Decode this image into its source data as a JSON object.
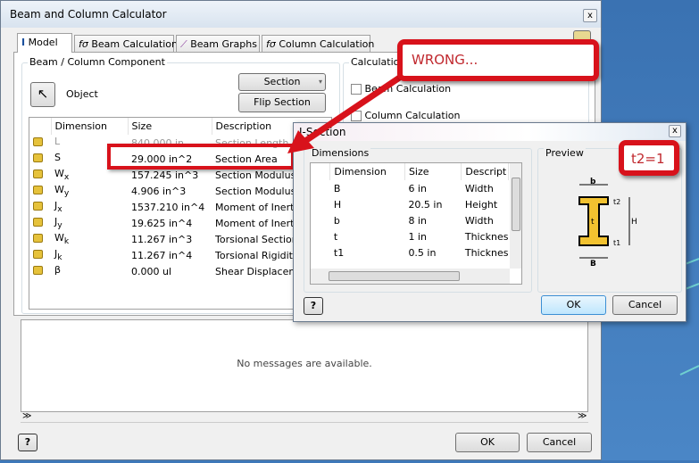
{
  "window": {
    "title": "Beam and Column Calculator",
    "close": "x"
  },
  "tabs": [
    {
      "label": "Model",
      "icon": "i-beam-icon"
    },
    {
      "label": "Beam Calculation",
      "icon": "function-icon"
    },
    {
      "label": "Beam Graphs",
      "icon": "graph-icon"
    },
    {
      "label": "Column Calculation",
      "icon": "function-icon"
    }
  ],
  "component": {
    "group_label": "Beam / Column Component",
    "object_label": "Object",
    "section_button": "Section",
    "flip_button": "Flip Section",
    "columns": [
      "Dimension",
      "Size",
      "Description"
    ],
    "rows": [
      {
        "dim": "L",
        "sub": "",
        "size": "840.000 in",
        "desc": "Section Length"
      },
      {
        "dim": "S",
        "sub": "",
        "size": "29.000 in^2",
        "desc": "Section Area"
      },
      {
        "dim": "W",
        "sub": "x",
        "size": "157.245 in^3",
        "desc": "Section Modulus"
      },
      {
        "dim": "W",
        "sub": "y",
        "size": "4.906 in^3",
        "desc": "Section Modulus"
      },
      {
        "dim": "J",
        "sub": "x",
        "size": "1537.210 in^4",
        "desc": "Moment of Inertia"
      },
      {
        "dim": "J",
        "sub": "y",
        "size": "19.625 in^4",
        "desc": "Moment of Inertia"
      },
      {
        "dim": "W",
        "sub": "k",
        "size": "11.267 in^3",
        "desc": "Torsional Section M"
      },
      {
        "dim": "J",
        "sub": "k",
        "size": "11.267 in^4",
        "desc": "Torsional Rigidity M"
      },
      {
        "dim": "β",
        "sub": "",
        "size": "0.000 ul",
        "desc": "Shear Displacement"
      }
    ]
  },
  "calculation": {
    "group_label": "Calculation",
    "beam": "Beam Calculation",
    "column": "Column Calculation"
  },
  "messages": {
    "empty": "No messages are available."
  },
  "footer": {
    "help": "?",
    "ok": "OK",
    "cancel": "Cancel",
    "splitter": "≫"
  },
  "isection": {
    "title": "I-Section",
    "dimensions_label": "Dimensions",
    "preview_label": "Preview",
    "columns": [
      "Dimension",
      "Size",
      "Descript"
    ],
    "rows": [
      {
        "dim": "B",
        "size": "6 in",
        "desc": "Width"
      },
      {
        "dim": "H",
        "size": "20.5 in",
        "desc": "Height"
      },
      {
        "dim": "b",
        "size": "8 in",
        "desc": "Width"
      },
      {
        "dim": "t",
        "size": "1 in",
        "desc": "Thicknes"
      },
      {
        "dim": "t1",
        "size": "0.5 in",
        "desc": "Thicknes"
      }
    ],
    "preview_labels": {
      "b": "b",
      "B": "B",
      "H": "H",
      "t": "t",
      "t1": "t1",
      "t2": "t2"
    },
    "ok": "OK",
    "cancel": "Cancel",
    "help": "?"
  },
  "annotations": {
    "wrong": "WRONG...",
    "t2": "t2=1",
    "color": "#d8121b"
  }
}
